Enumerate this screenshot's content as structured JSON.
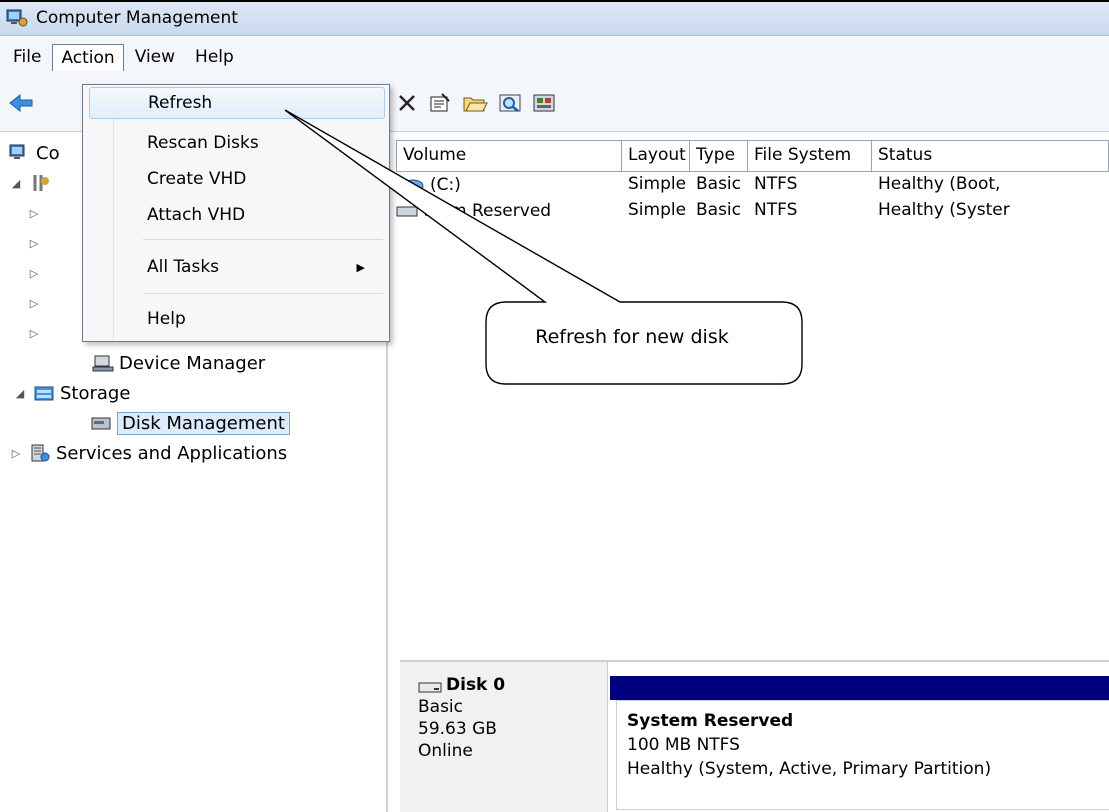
{
  "window": {
    "title": "Computer Management"
  },
  "menubar": {
    "items": [
      "File",
      "Action",
      "View",
      "Help"
    ]
  },
  "toolbar": {
    "icons": [
      "back-arrow-icon",
      "delete-icon",
      "properties-icon",
      "open-folder-icon",
      "zoom-icon",
      "disk-icon"
    ]
  },
  "action_menu": {
    "items": [
      "Refresh",
      "Rescan Disks",
      "Create VHD",
      "Attach VHD",
      "All Tasks",
      "Help"
    ]
  },
  "tree": {
    "root_label_partial": "Co",
    "device_manager": "Device Manager",
    "storage": "Storage",
    "disk_management": "Disk Management",
    "services": "Services and Applications"
  },
  "volume_table": {
    "columns": [
      "Volume",
      "Layout",
      "Type",
      "File System",
      "Status"
    ],
    "rows": [
      {
        "volume": "(C:)",
        "layout": "Simple",
        "type": "Basic",
        "fs": "NTFS",
        "status": "Healthy (Boot,"
      },
      {
        "volume": "stem Reserved",
        "layout": "Simple",
        "type": "Basic",
        "fs": "NTFS",
        "status": "Healthy (Syster"
      }
    ]
  },
  "disk": {
    "name": "Disk 0",
    "type": "Basic",
    "size": "59.63 GB",
    "state": "Online",
    "partition_name": "System Reserved",
    "partition_info": "100 MB NTFS",
    "partition_status": "Healthy (System, Active, Primary Partition)"
  },
  "callout": {
    "text": "Refresh for new disk"
  },
  "colors": {
    "partition_bar": "#000080",
    "selection": "#dcebfc"
  }
}
